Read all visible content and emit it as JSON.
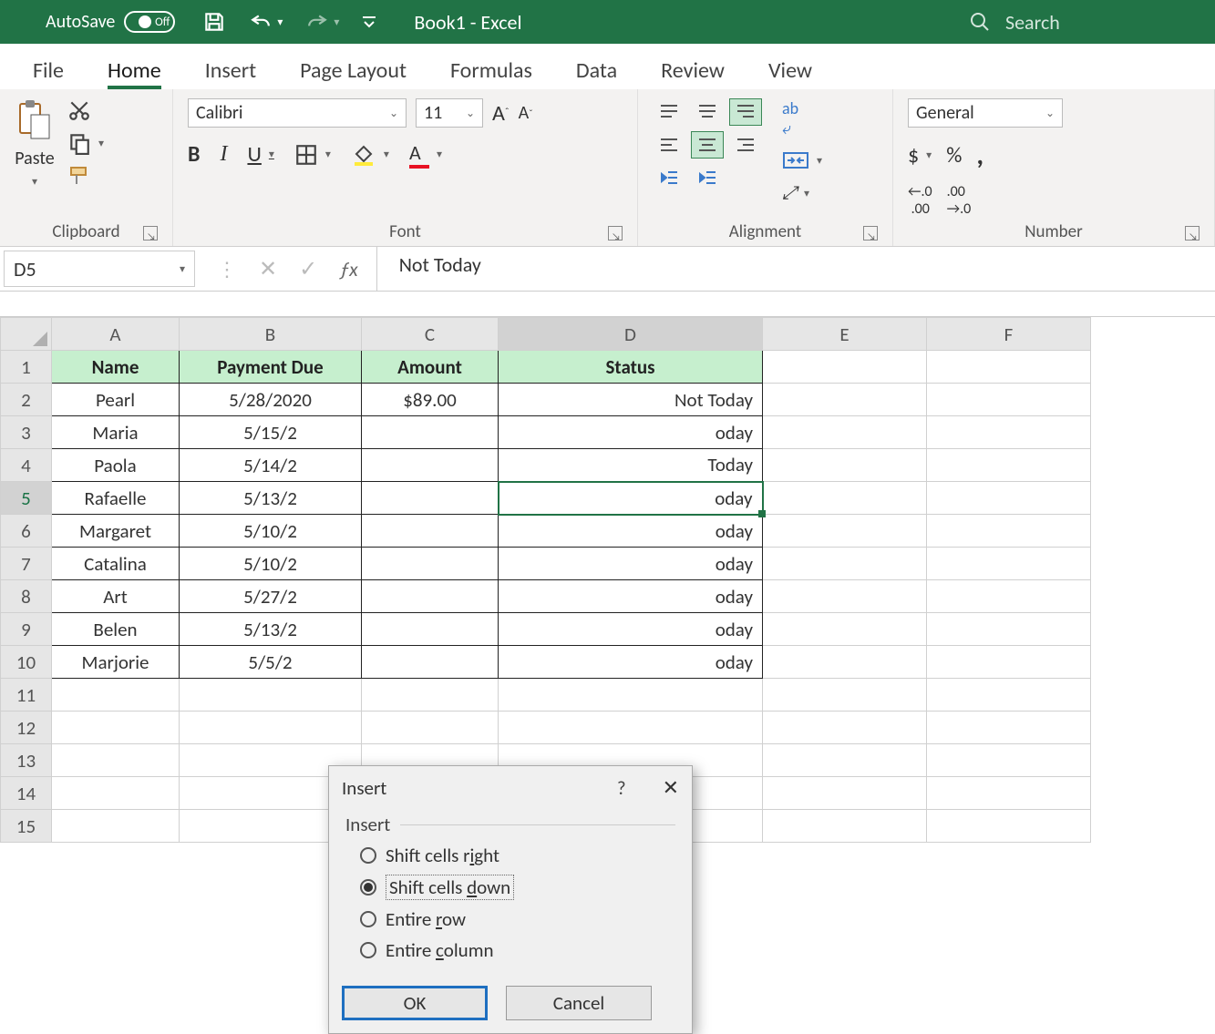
{
  "titlebar": {
    "autosave_label": "AutoSave",
    "autosave_state": "Off",
    "doc_title": "Book1 - Excel",
    "search_placeholder": "Search"
  },
  "tabs": [
    "File",
    "Home",
    "Insert",
    "Page Layout",
    "Formulas",
    "Data",
    "Review",
    "View"
  ],
  "active_tab": "Home",
  "ribbon": {
    "clipboard_label": "Clipboard",
    "paste_label": "Paste",
    "font_label": "Font",
    "font_name": "Calibri",
    "font_size": "11",
    "alignment_label": "Alignment",
    "number_label": "Number",
    "number_format": "General"
  },
  "formula_bar": {
    "name_box": "D5",
    "value": "Not Today"
  },
  "columns": [
    "A",
    "B",
    "C",
    "D",
    "E",
    "F"
  ],
  "headers": [
    "Name",
    "Payment Due",
    "Amount",
    "Status"
  ],
  "rows": [
    {
      "n": "1"
    },
    {
      "n": "2",
      "c": [
        "Pearl",
        "5/28/2020",
        "$89.00",
        "Not Today"
      ]
    },
    {
      "n": "3",
      "c": [
        "Maria",
        "5/15/2",
        "",
        "oday"
      ]
    },
    {
      "n": "4",
      "c": [
        "Paola",
        "5/14/2",
        "",
        " Today"
      ]
    },
    {
      "n": "5",
      "c": [
        "Rafaelle",
        "5/13/2",
        "",
        "oday"
      ],
      "sel": true
    },
    {
      "n": "6",
      "c": [
        "Margaret",
        "5/10/2",
        "",
        "oday"
      ]
    },
    {
      "n": "7",
      "c": [
        "Catalina",
        "5/10/2",
        "",
        "oday"
      ]
    },
    {
      "n": "8",
      "c": [
        "Art",
        "5/27/2",
        "",
        "oday"
      ]
    },
    {
      "n": "9",
      "c": [
        "Belen",
        "5/13/2",
        "",
        "oday"
      ]
    },
    {
      "n": "10",
      "c": [
        "Marjorie",
        "5/5/2",
        "",
        "oday"
      ]
    },
    {
      "n": "11"
    },
    {
      "n": "12"
    },
    {
      "n": "13"
    },
    {
      "n": "14"
    },
    {
      "n": "15"
    }
  ],
  "dialog": {
    "title": "Insert",
    "group_label": "Insert",
    "options": {
      "shift_right": "Shift cells right",
      "shift_down": "Shift cells down",
      "entire_row": "Entire row",
      "entire_col": "Entire column"
    },
    "ok": "OK",
    "cancel": "Cancel"
  }
}
